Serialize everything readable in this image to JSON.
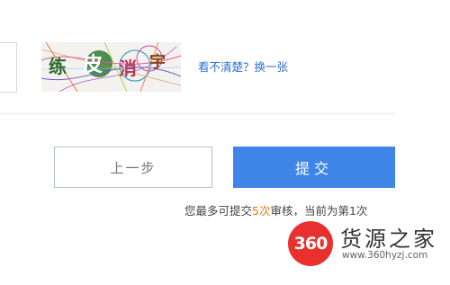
{
  "captcha": {
    "chars": [
      "练",
      "皮",
      "消",
      "宇"
    ],
    "refresh_label": "看不清楚？换一张"
  },
  "buttons": {
    "prev_label": "上一步",
    "submit_label": "提交"
  },
  "notice": {
    "prefix": "您最多可提交",
    "highlight": "5次",
    "suffix": "审核，当前为第1次"
  },
  "watermark": {
    "logo_text": "360",
    "brand": "货源之家",
    "url": "www.360hyzj.com"
  },
  "colors": {
    "primary": "#3f85e8",
    "link": "#2a6fce",
    "accent": "#e07a1a",
    "logo": "#e8312f"
  }
}
